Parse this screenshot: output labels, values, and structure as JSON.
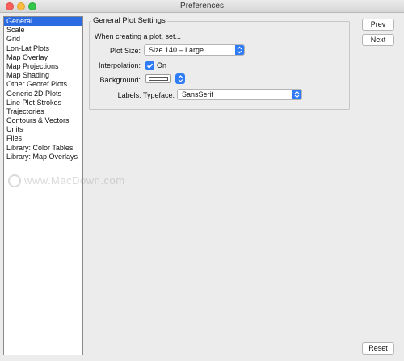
{
  "window": {
    "title": "Preferences"
  },
  "sidebar": {
    "items": [
      {
        "label": "General",
        "selected": true
      },
      {
        "label": "Scale"
      },
      {
        "label": "Grid"
      },
      {
        "label": "Lon-Lat Plots"
      },
      {
        "label": "Map Overlay"
      },
      {
        "label": "Map Projections"
      },
      {
        "label": "Map Shading"
      },
      {
        "label": "Other Georef Plots"
      },
      {
        "label": "Generic 2D Plots"
      },
      {
        "label": "Line Plot Strokes"
      },
      {
        "label": "Trajectories"
      },
      {
        "label": "Contours & Vectors"
      },
      {
        "label": "Units"
      },
      {
        "label": "Files"
      },
      {
        "label": "Library: Color Tables"
      },
      {
        "label": "Library: Map Overlays"
      }
    ]
  },
  "panel": {
    "group_title": "General Plot Settings",
    "intro": "When creating a plot, set...",
    "plot_size": {
      "label": "Plot Size:",
      "value": "Size 140 – Large"
    },
    "interpolation": {
      "label": "Interpolation:",
      "checkbox_label": "On",
      "checked": true
    },
    "background": {
      "label": "Background:",
      "color": "#ffffff"
    },
    "labels": {
      "label": "Labels: Typeface:",
      "value": "SansSerif"
    }
  },
  "buttons": {
    "prev": "Prev",
    "next": "Next",
    "reset": "Reset"
  },
  "watermark": {
    "text": "www.MacDown.com"
  },
  "colors": {
    "accent": "#2f7cf6",
    "selection": "#2a6be3"
  }
}
